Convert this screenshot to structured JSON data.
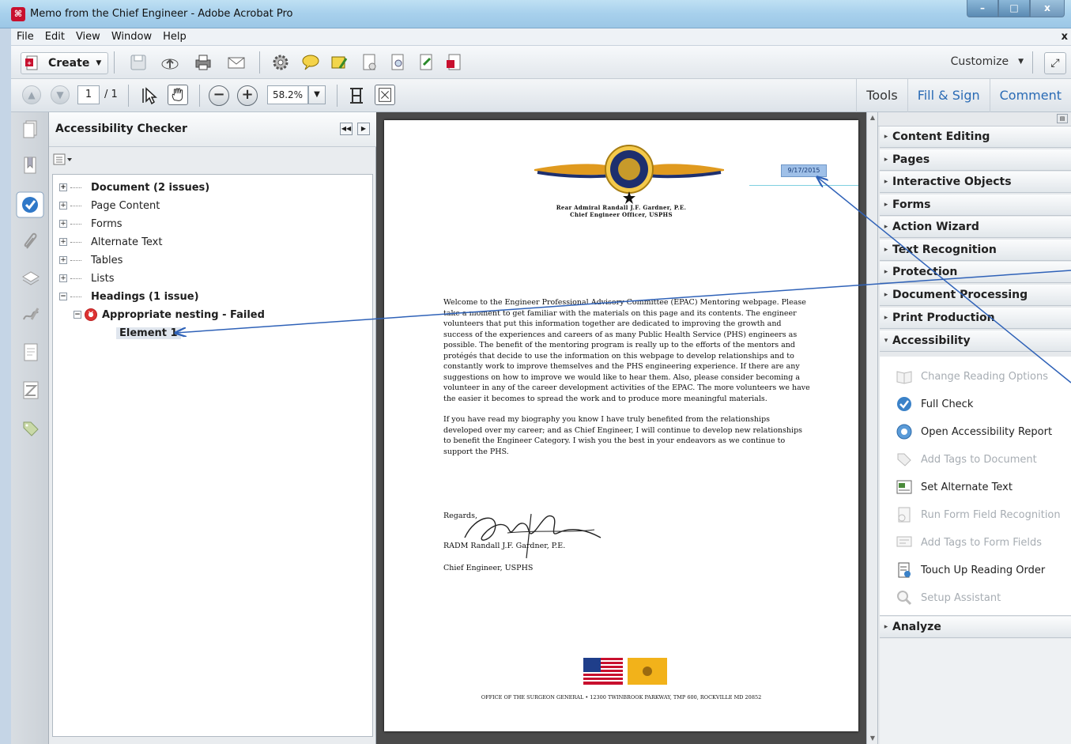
{
  "window": {
    "title": "Memo from the Chief Engineer - Adobe Acrobat Pro",
    "app_icon": "acrobat-icon",
    "controls": {
      "minimize": "–",
      "maximize": "□",
      "close": "x"
    }
  },
  "menubar": {
    "items": [
      "File",
      "Edit",
      "View",
      "Window",
      "Help"
    ],
    "close": "x"
  },
  "toolbar": {
    "create_label": "Create",
    "customize_label": "Customize",
    "icons": [
      "save-icon",
      "cloud-upload-icon",
      "print-icon",
      "email-icon",
      "gear-icon",
      "comment-icon",
      "sticky-note-icon",
      "page-icon",
      "page-export-icon",
      "page-edit-icon",
      "form-icon"
    ]
  },
  "navbar": {
    "page_current": "1",
    "page_total": "/ 1",
    "zoom": "58.2%"
  },
  "tabs": {
    "tools": "Tools",
    "fill_sign": "Fill & Sign",
    "comment": "Comment"
  },
  "checker": {
    "title": "Accessibility Checker",
    "tree": [
      {
        "label": "Document (2 issues)",
        "bold": true
      },
      {
        "label": "Page Content"
      },
      {
        "label": "Forms"
      },
      {
        "label": "Alternate Text"
      },
      {
        "label": "Tables"
      },
      {
        "label": "Lists"
      },
      {
        "label": "Headings (1 issue)",
        "bold": true
      },
      {
        "label": "Appropriate nesting - Failed",
        "bold": true
      },
      {
        "label": "Element 1",
        "bold": true
      }
    ]
  },
  "document": {
    "date_text": "9/17/2015",
    "letterhead_line1": "Rear Admiral Randall J.F. Gardner, P.E.",
    "letterhead_line2": "Chief Engineer Officer, USPHS",
    "paragraph1": "Welcome to the Engineer Professional Advisory Committee (EPAC) Mentoring webpage. Please take a moment to get familiar with the materials on this page and its contents. The engineer volunteers that put this information together are dedicated to improving the growth and success of the experiences and careers of as many Public Health Service (PHS) engineers as possible. The benefit of the mentoring program is really up to the efforts of the mentors and protégés that decide to use the information on this webpage to develop relationships and to constantly work to improve themselves and the PHS engineering experience. If there are any suggestions on how to improve we would like to hear them. Also, please consider becoming a volunteer in any of the career development activities of the EPAC. The more volunteers we have the easier it becomes to spread the work and to produce more meaningful materials.",
    "paragraph2": "If you have read my biography you know I have truly benefited from the relationships developed over my career; and as Chief Engineer, I will continue to develop new relationships to benefit the Engineer Category. I wish you the best in your endeavors as we continue to support the PHS.",
    "regards": "Regards,",
    "signer": "RADM Randall J.F. Gardner, P.E.",
    "signer_title": "Chief Engineer, USPHS",
    "footer": "OFFICE OF THE SURGEON GENERAL • 12300 TWINBROOK PARKWAY, TMP 600, ROCKVILLE MD 20852"
  },
  "tools_pane": {
    "sections": [
      "Content Editing",
      "Pages",
      "Interactive Objects",
      "Forms",
      "Action Wizard",
      "Text Recognition",
      "Protection",
      "Document Processing",
      "Print Production"
    ],
    "accessibility_label": "Accessibility",
    "accessibility_items": [
      {
        "label": "Change Reading Options",
        "dim": true,
        "icon": "book-icon"
      },
      {
        "label": "Full Check",
        "dim": false,
        "icon": "check-icon"
      },
      {
        "label": "Open Accessibility Report",
        "dim": false,
        "icon": "report-icon"
      },
      {
        "label": "Add Tags to Document",
        "dim": true,
        "icon": "tag-icon"
      },
      {
        "label": "Set Alternate Text",
        "dim": false,
        "icon": "alt-text-icon"
      },
      {
        "label": "Run Form Field Recognition",
        "dim": true,
        "icon": "form-recognition-icon"
      },
      {
        "label": "Add Tags to Form Fields",
        "dim": true,
        "icon": "tag-fields-icon"
      },
      {
        "label": "Touch Up Reading Order",
        "dim": false,
        "icon": "reading-order-icon"
      },
      {
        "label": "Setup Assistant",
        "dim": true,
        "icon": "magnifier-icon"
      }
    ],
    "analyze_label": "Analyze"
  },
  "colors": {
    "accent_blue": "#2a6bb5",
    "error_red": "#d33333",
    "annotation_line": "#2f62b8"
  }
}
